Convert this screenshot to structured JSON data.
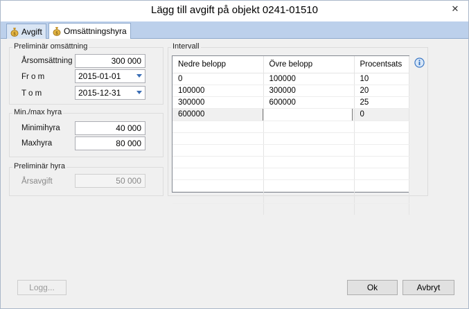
{
  "window": {
    "title": "Lägg till avgift på objekt 0241-01510",
    "close_glyph": "✕"
  },
  "tabs": [
    {
      "label": "Avgift",
      "active": false,
      "icon": "money-bag-icon"
    },
    {
      "label": "Omsättningshyra",
      "active": true,
      "icon": "money-bag-icon"
    }
  ],
  "prelim_omsattning": {
    "legend": "Preliminär omsättning",
    "arsomsattning_label": "Årsomsättning",
    "arsomsattning_value": "300 000",
    "from_label": "Fr o m",
    "from_value": "2015-01-01",
    "tom_label": "T o m",
    "tom_value": "2015-12-31"
  },
  "minmax": {
    "legend": "Min./max hyra",
    "min_label": "Minimihyra",
    "min_value": "40 000",
    "max_label": "Maxhyra",
    "max_value": "80 000"
  },
  "prelim_hyra": {
    "legend": "Preliminär hyra",
    "arsavgift_label": "Årsavgift",
    "arsavgift_value": "50 000"
  },
  "intervall": {
    "legend": "Intervall",
    "columns": [
      "Nedre belopp",
      "Övre belopp",
      "Procentsats"
    ],
    "rows": [
      [
        "0",
        "100000",
        "10"
      ],
      [
        "100000",
        "300000",
        "20"
      ],
      [
        "300000",
        "600000",
        "25"
      ],
      [
        "600000",
        "",
        "0"
      ]
    ],
    "info_icon": "info-icon"
  },
  "buttons": {
    "logg": "Logg...",
    "ok": "Ok",
    "avbryt": "Avbryt"
  },
  "colors": {
    "tabstrip": "#bcd0eb",
    "info": "#2f6fc1"
  }
}
